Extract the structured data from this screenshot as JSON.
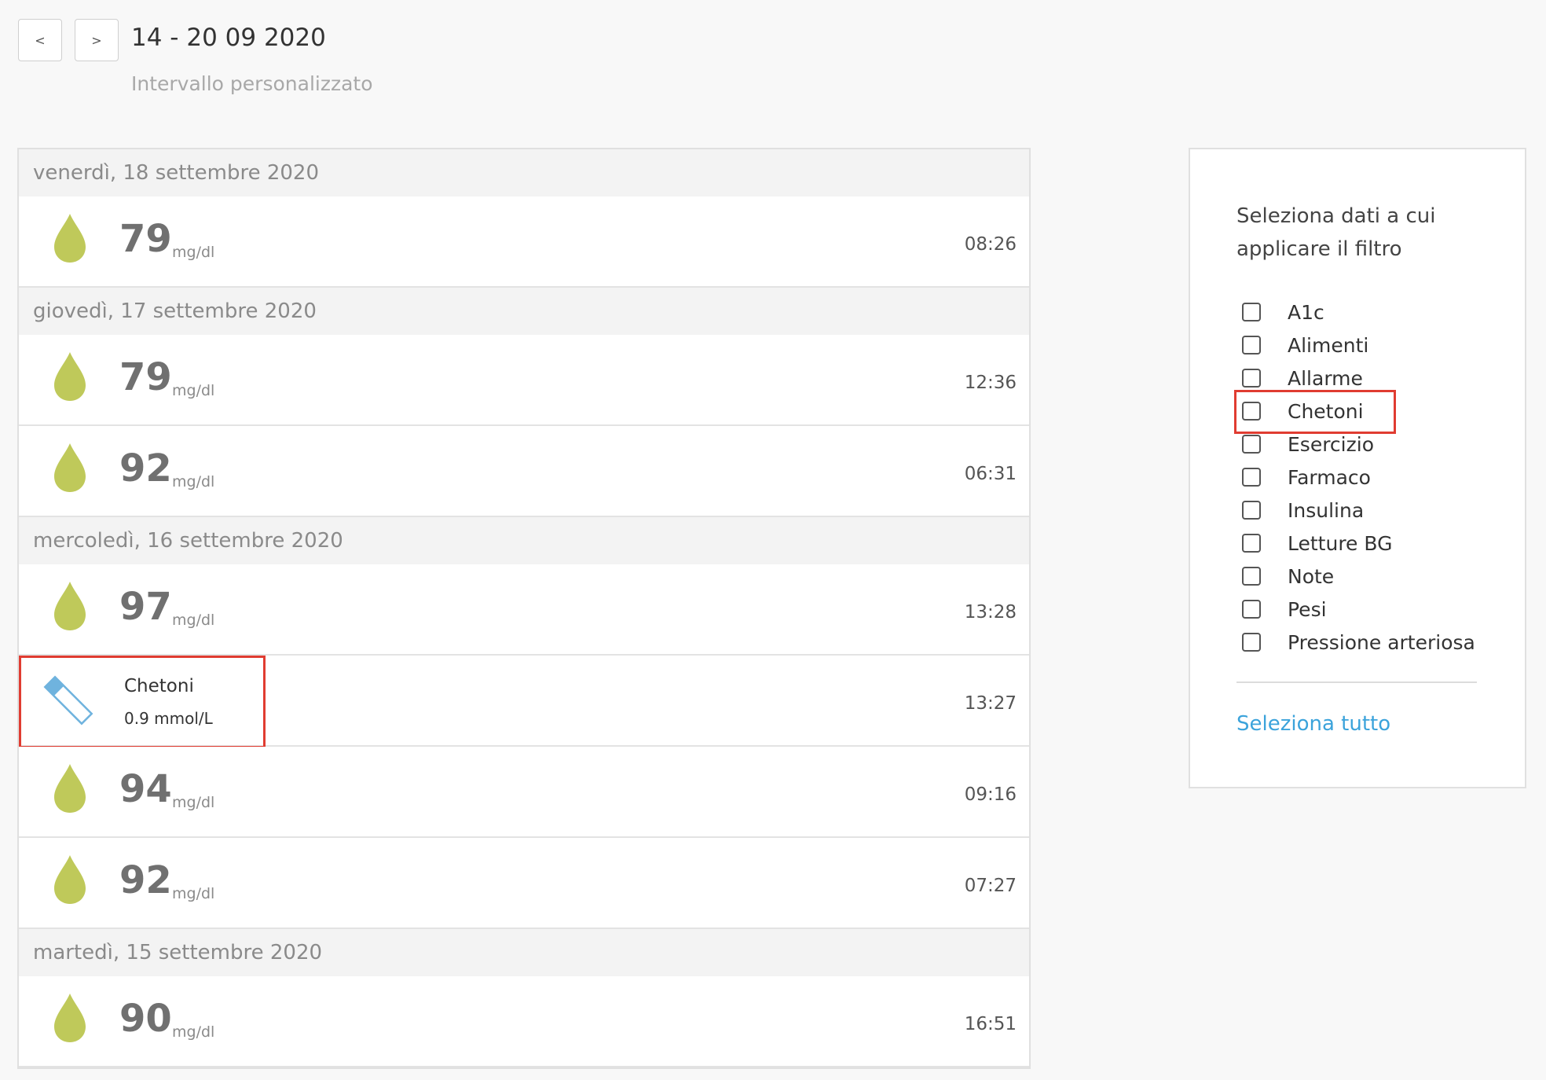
{
  "header": {
    "prev_label": "<",
    "next_label": ">",
    "range_title": "14 - 20 09 2020",
    "range_subtitle": "Intervallo personalizzato"
  },
  "colors": {
    "drop": "#bfc95a",
    "ketone_strip": "#6fb3de",
    "highlight": "#e03c31",
    "link": "#3ba3db"
  },
  "log": {
    "days": [
      {
        "date": "venerdì, 18 settembre 2020",
        "entries": [
          {
            "type": "bg",
            "icon": "drop-icon",
            "value": "79",
            "unit": "mg/dl",
            "time": "08:26"
          }
        ]
      },
      {
        "date": "giovedì, 17 settembre 2020",
        "entries": [
          {
            "type": "bg",
            "icon": "drop-icon",
            "value": "79",
            "unit": "mg/dl",
            "time": "12:36"
          },
          {
            "type": "bg",
            "icon": "drop-icon",
            "value": "92",
            "unit": "mg/dl",
            "time": "06:31"
          }
        ]
      },
      {
        "date": "mercoledì, 16 settembre 2020",
        "entries": [
          {
            "type": "bg",
            "icon": "drop-icon",
            "value": "97",
            "unit": "mg/dl",
            "time": "13:28"
          },
          {
            "type": "ketone",
            "icon": "test-strip-icon",
            "label": "Chetoni",
            "value": "0.9 mmol/L",
            "time": "13:27",
            "highlighted": true
          },
          {
            "type": "bg",
            "icon": "drop-icon",
            "value": "94",
            "unit": "mg/dl",
            "time": "09:16"
          },
          {
            "type": "bg",
            "icon": "drop-icon",
            "value": "92",
            "unit": "mg/dl",
            "time": "07:27"
          }
        ]
      },
      {
        "date": "martedì, 15 settembre 2020",
        "entries": [
          {
            "type": "bg",
            "icon": "drop-icon",
            "value": "90",
            "unit": "mg/dl",
            "time": "16:51"
          }
        ]
      }
    ]
  },
  "filter": {
    "title": "Seleziona dati a cui applicare il filtro",
    "options": [
      {
        "label": "A1c",
        "checked": false
      },
      {
        "label": "Alimenti",
        "checked": false
      },
      {
        "label": "Allarme",
        "checked": false
      },
      {
        "label": "Chetoni",
        "checked": false,
        "highlighted": true
      },
      {
        "label": "Esercizio",
        "checked": false
      },
      {
        "label": "Farmaco",
        "checked": false
      },
      {
        "label": "Insulina",
        "checked": false
      },
      {
        "label": "Letture BG",
        "checked": false
      },
      {
        "label": "Note",
        "checked": false
      },
      {
        "label": "Pesi",
        "checked": false
      },
      {
        "label": "Pressione arteriosa",
        "checked": false
      }
    ],
    "select_all_label": "Seleziona tutto"
  }
}
